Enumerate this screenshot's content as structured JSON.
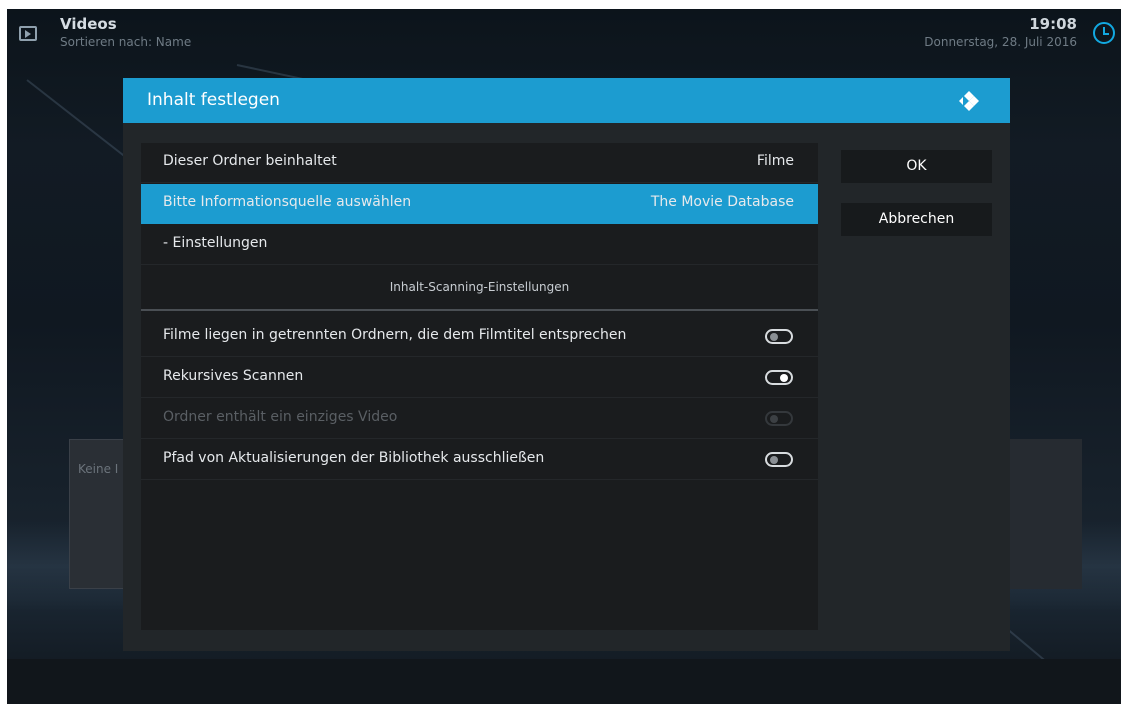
{
  "header": {
    "title": "Videos",
    "subtitle": "Sortieren nach: Name",
    "time": "19:08",
    "date": "Donnerstag, 28. Juli 2016"
  },
  "background": {
    "panel_text": "Keine I"
  },
  "dialog": {
    "title": "Inhalt festlegen",
    "rows": {
      "content_type": {
        "label": "Dieser Ordner beinhaltet",
        "value": "Filme"
      },
      "info_source": {
        "label": "Bitte Informationsquelle auswählen",
        "value": "The Movie Database"
      },
      "settings": {
        "label": "- Einstellungen"
      }
    },
    "section_title": "Inhalt-Scanning-Einstellungen",
    "toggles": [
      {
        "label": "Filme liegen in getrennten Ordnern, die dem Filmtitel entsprechen",
        "state": "off",
        "enabled": true
      },
      {
        "label": "Rekursives Scannen",
        "state": "on",
        "enabled": true
      },
      {
        "label": "Ordner enthält ein einziges Video",
        "state": "off",
        "enabled": false
      },
      {
        "label": "Pfad von Aktualisierungen der Bibliothek ausschließen",
        "state": "off",
        "enabled": true
      }
    ],
    "buttons": {
      "ok": "OK",
      "cancel": "Abbrechen"
    }
  },
  "colors": {
    "accent": "#1c9cd0",
    "clock_icon": "#12a8e0"
  },
  "icons": {
    "app": "videos-icon",
    "clock": "clock-icon",
    "dialog_logo": "kodi-logo-icon"
  }
}
